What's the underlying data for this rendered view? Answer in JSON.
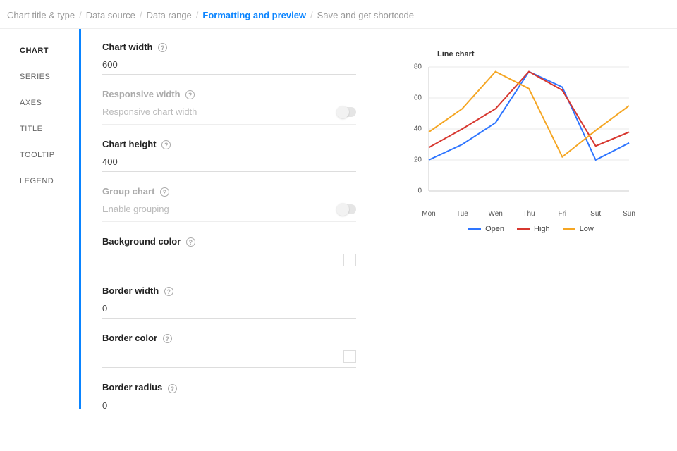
{
  "breadcrumb": {
    "items": [
      "Chart title & type",
      "Data source",
      "Data range",
      "Formatting and preview",
      "Save and get shortcode"
    ],
    "active_index": 3
  },
  "sidebar": {
    "items": [
      "CHART",
      "SERIES",
      "AXES",
      "TITLE",
      "TOOLTIP",
      "LEGEND"
    ],
    "active_index": 0
  },
  "form": {
    "chart_width": {
      "label": "Chart width",
      "value": "600"
    },
    "responsive_width": {
      "label": "Responsive width",
      "toggle_text": "Responsive chart width",
      "enabled": false
    },
    "chart_height": {
      "label": "Chart height",
      "value": "400"
    },
    "group_chart": {
      "label": "Group chart",
      "toggle_text": "Enable grouping",
      "enabled": false
    },
    "background_color": {
      "label": "Background color",
      "value": ""
    },
    "border_width": {
      "label": "Border width",
      "value": "0"
    },
    "border_color": {
      "label": "Border color",
      "value": ""
    },
    "border_radius": {
      "label": "Border radius",
      "value": "0"
    }
  },
  "chart_data": {
    "type": "line",
    "title": "Line chart",
    "categories": [
      "Mon",
      "Tue",
      "Wen",
      "Thu",
      "Fri",
      "Sut",
      "Sun"
    ],
    "ylim": [
      0,
      80
    ],
    "yticks": [
      0,
      20,
      40,
      60,
      80
    ],
    "series": [
      {
        "name": "Open",
        "color": "#2e75ff",
        "values": [
          20,
          30,
          44,
          77,
          67,
          20,
          31
        ]
      },
      {
        "name": "High",
        "color": "#d7372f",
        "values": [
          28,
          40,
          53,
          77,
          65,
          29,
          38
        ]
      },
      {
        "name": "Low",
        "color": "#f5a623",
        "values": [
          38,
          53,
          77,
          66,
          22,
          39,
          55
        ]
      }
    ]
  }
}
